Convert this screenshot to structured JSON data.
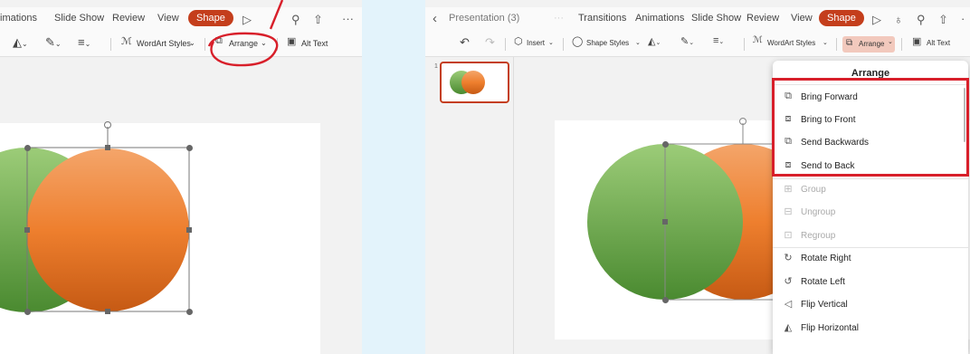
{
  "left": {
    "tabs": {
      "animations": "imations",
      "slide_show": "Slide Show",
      "review": "Review",
      "view": "View",
      "shape": "Shape"
    },
    "toolbar": {
      "wordart_styles": "WordArt Styles",
      "arrange": "Arrange",
      "alt_text": "Alt Text"
    }
  },
  "right": {
    "title": "Presentation (3)",
    "tabs": {
      "transitions": "Transitions",
      "animations": "Animations",
      "slide_show": "Slide Show",
      "review": "Review",
      "view": "View",
      "shape": "Shape"
    },
    "toolbar": {
      "insert": "Insert",
      "shape_styles": "Shape Styles",
      "wordart_styles": "WordArt Styles",
      "arrange": "Arrange",
      "alt_text": "Alt Text"
    },
    "slide_number": "1"
  },
  "arrange_menu": {
    "title": "Arrange",
    "items": [
      {
        "label": "Bring Forward",
        "icon": "bring-forward-icon",
        "enabled": true
      },
      {
        "label": "Bring to Front",
        "icon": "bring-to-front-icon",
        "enabled": true
      },
      {
        "label": "Send Backwards",
        "icon": "send-backwards-icon",
        "enabled": true
      },
      {
        "label": "Send to Back",
        "icon": "send-to-back-icon",
        "enabled": true
      },
      {
        "label": "Group",
        "icon": "group-icon",
        "enabled": false
      },
      {
        "label": "Ungroup",
        "icon": "ungroup-icon",
        "enabled": false
      },
      {
        "label": "Regroup",
        "icon": "regroup-icon",
        "enabled": false
      },
      {
        "label": "Rotate Right",
        "icon": "rotate-right-icon",
        "enabled": true
      },
      {
        "label": "Rotate Left",
        "icon": "rotate-left-icon",
        "enabled": true
      },
      {
        "label": "Flip Vertical",
        "icon": "flip-vertical-icon",
        "enabled": true
      },
      {
        "label": "Flip Horizontal",
        "icon": "flip-horizontal-icon",
        "enabled": true
      }
    ]
  },
  "colors": {
    "accent": "#c43e1c",
    "annotation": "#d81f2a",
    "green": "#5e9e3c",
    "orange": "#ec7f2c"
  }
}
